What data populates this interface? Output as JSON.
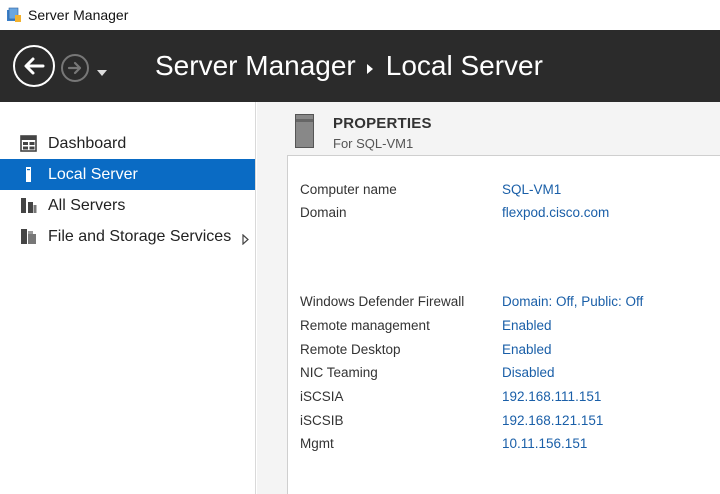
{
  "window": {
    "title": "Server Manager"
  },
  "header": {
    "breadcrumb_root": "Server Manager",
    "breadcrumb_current": "Local Server"
  },
  "sidebar": {
    "items": [
      {
        "label": "Dashboard",
        "icon": "dashboard-icon",
        "selected": false
      },
      {
        "label": "Local Server",
        "icon": "local-server-icon",
        "selected": true
      },
      {
        "label": "All Servers",
        "icon": "all-servers-icon",
        "selected": false
      },
      {
        "label": "File and Storage Services",
        "icon": "file-storage-icon",
        "selected": false
      }
    ]
  },
  "properties": {
    "title": "PROPERTIES",
    "subtitle": "For SQL-VM1",
    "rows": [
      {
        "label": "Computer name",
        "value": "SQL-VM1"
      },
      {
        "label": "Domain",
        "value": "flexpod.cisco.com"
      },
      {
        "label": "Windows Defender Firewall",
        "value": "Domain: Off, Public: Off"
      },
      {
        "label": "Remote management",
        "value": "Enabled"
      },
      {
        "label": "Remote Desktop",
        "value": "Enabled"
      },
      {
        "label": "NIC Teaming",
        "value": "Disabled"
      },
      {
        "label": "iSCSIA",
        "value": "192.168.111.151"
      },
      {
        "label": "iSCSIB",
        "value": "192.168.121.151"
      },
      {
        "label": "Mgmt",
        "value": "10.11.156.151"
      }
    ]
  },
  "colors": {
    "header": "#2b2b2b",
    "selection": "#0a6bc4",
    "link": "#1a5fa8"
  }
}
